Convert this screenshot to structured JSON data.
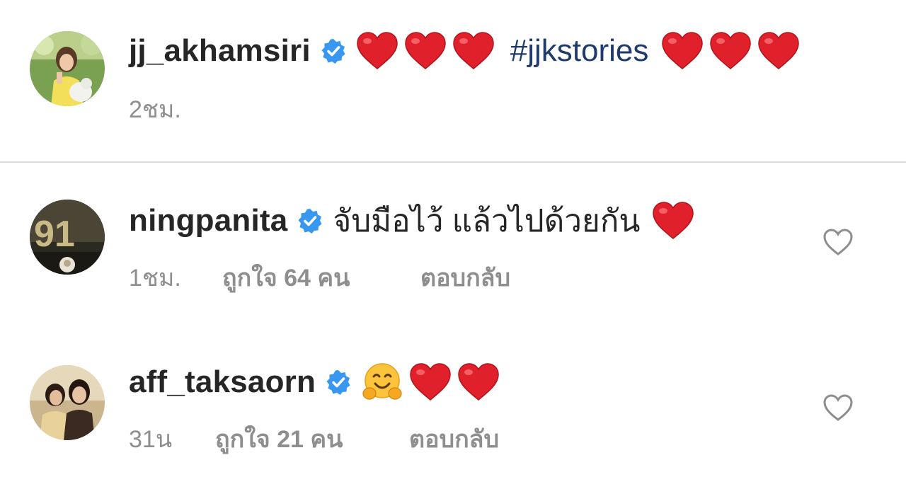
{
  "caption": {
    "username": "jj_akhamsiri",
    "hashtag": "#jjkstories",
    "time": "2ชม.",
    "avatar_icon": "profile-photo-woman-with-dog",
    "hearts_before": 3,
    "hearts_after": 3
  },
  "comments": [
    {
      "username": "ningpanita",
      "text": "จับมือไว้ แล้วไปด้วยกัน",
      "time": "1ชม.",
      "likes": "ถูกใจ 64 คน",
      "reply": "ตอบกลับ",
      "emojis": [
        "red-heart"
      ],
      "avatar_icon": "profile-photo-number-91"
    },
    {
      "username": "aff_taksaorn",
      "text": "",
      "time": "31น",
      "likes": "ถูกใจ 21 คน",
      "reply": "ตอบกลับ",
      "emojis": [
        "hugging-face",
        "red-heart",
        "red-heart"
      ],
      "avatar_icon": "profile-photo-two-people"
    }
  ],
  "colors": {
    "verified_blue": "#3897f0",
    "heart_red": "#e0202a",
    "hashtag_blue": "#1f3a6d",
    "meta_gray": "#8e8e8e",
    "divider": "#dbdbdb"
  }
}
